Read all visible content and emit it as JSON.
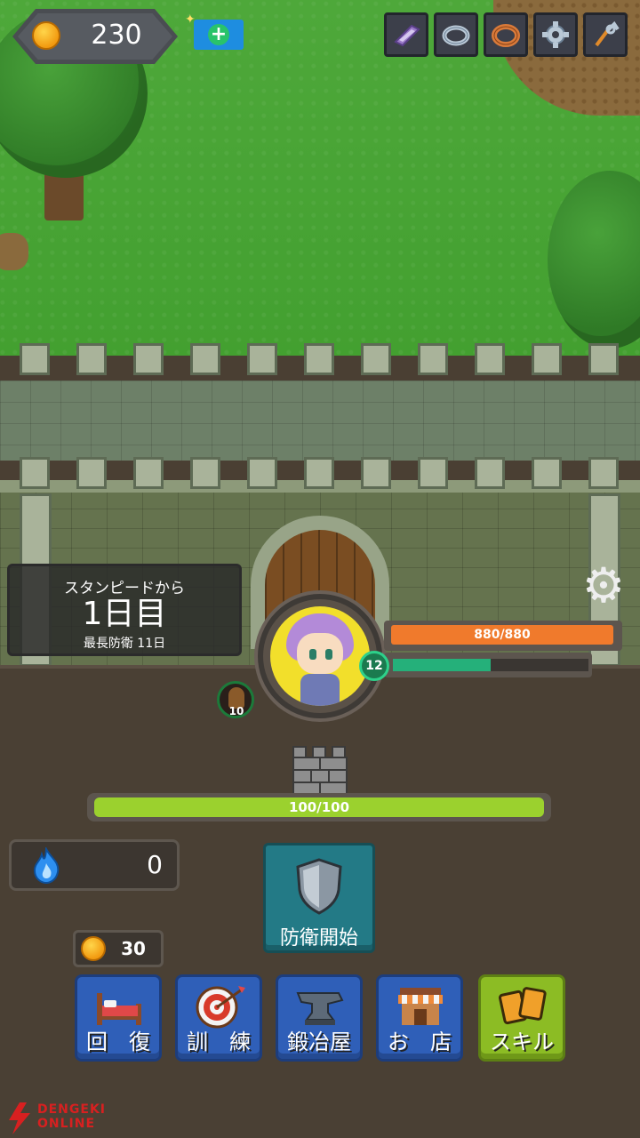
{
  "hud": {
    "gold": "230",
    "equipment_icons": [
      "whetstone-icon",
      "ring-icon",
      "bronze-ring-icon",
      "gear-icon",
      "tongs-icon"
    ]
  },
  "stampede": {
    "line1": "スタンピードから",
    "day": "1日目",
    "record": "最長防衛 11日"
  },
  "hero": {
    "level": "12",
    "hp_text": "880/880",
    "hp_fraction": 1.0,
    "xp_fraction": 0.5
  },
  "enemy": {
    "count": "10"
  },
  "wall": {
    "hp_text": "100/100",
    "hp_fraction": 1.0
  },
  "soul": {
    "value": "0"
  },
  "defend": {
    "label": "防衛開始"
  },
  "cost": {
    "value": "30"
  },
  "menu": [
    {
      "label": "回　復",
      "icon": "bed-icon"
    },
    {
      "label": "訓　練",
      "icon": "target-icon"
    },
    {
      "label": "鍛冶屋",
      "icon": "anvil-icon"
    },
    {
      "label": "お　店",
      "icon": "shop-icon"
    },
    {
      "label": "スキル",
      "icon": "cards-icon"
    }
  ],
  "colors": {
    "hp": "#f07a2c",
    "xp": "#25b07a",
    "wall_hp": "#9bd12e",
    "menu_blue": "#2f5fb8",
    "skill_green": "#8cbc24",
    "defend_teal": "#237a86"
  },
  "watermark": {
    "line1": "DENGEKI",
    "line2": "ONLINE"
  }
}
